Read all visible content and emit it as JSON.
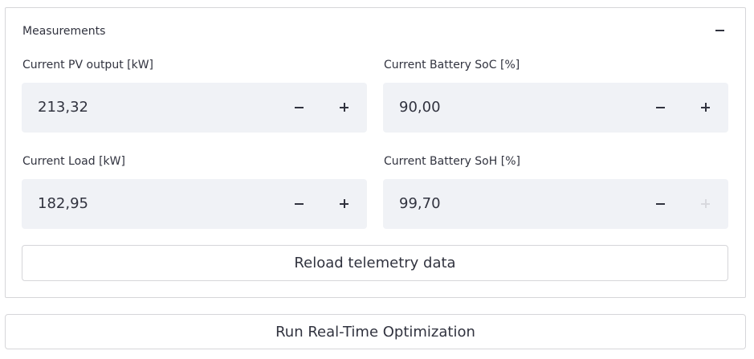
{
  "expander": {
    "title": "Measurements",
    "collapse_icon": "minus-icon"
  },
  "fields": {
    "pv_output": {
      "label": "Current PV output [kW]",
      "value": "213,32"
    },
    "battery_soc": {
      "label": "Current Battery SoC [%]",
      "value": "90,00"
    },
    "load": {
      "label": "Current Load [kW]",
      "value": "182,95"
    },
    "battery_soh": {
      "label": "Current Battery SoH [%]",
      "value": "99,70"
    }
  },
  "buttons": {
    "reload_label": "Reload telemetry data",
    "optimize_label": "Run Real-Time Optimization"
  },
  "icons": {
    "decrement": "minus-icon",
    "increment": "plus-icon"
  },
  "colors": {
    "text": "#31333f",
    "input_bg": "#f0f2f6",
    "border": "#d6d6d9",
    "disabled_icon": "#d8d9de"
  }
}
